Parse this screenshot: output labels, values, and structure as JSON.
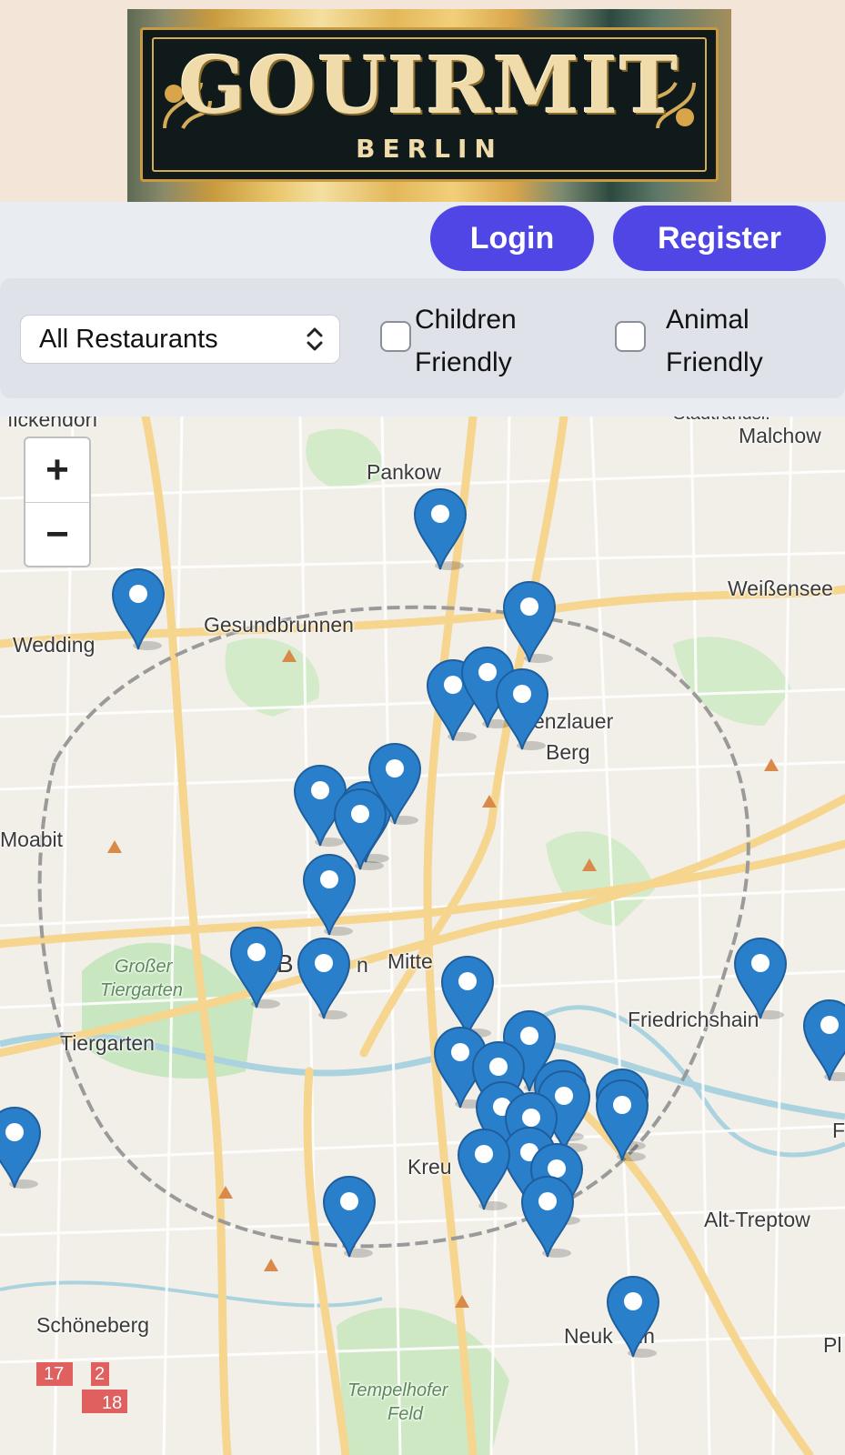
{
  "logo": {
    "title": "GOUIRMIT",
    "subtitle": "BERLIN"
  },
  "auth": {
    "login_label": "Login",
    "register_label": "Register"
  },
  "filters": {
    "restaurant_select": {
      "value": "All Restaurants"
    },
    "children_friendly": {
      "label": "Children Friendly",
      "checked": false
    },
    "animal_friendly": {
      "label": "Animal Friendly",
      "checked": false
    }
  },
  "map": {
    "zoom_in": "+",
    "zoom_out": "−",
    "labels": {
      "reinickendorf": "ıickendorf",
      "stadtrand": "Stadtrandsi.",
      "malchow": "Malchow",
      "pankow": "Pankow",
      "weissensee": "Weißensee",
      "gesundbrunnen": "Gesundbrunnen",
      "wedding": "Wedding",
      "prenzlauer": "enzlauer",
      "berg": "Berg",
      "moabit": "Moabit",
      "grosser": "Großer",
      "tiergarten_park": "Tiergarten",
      "berlin_b": "B",
      "berlin_n": "n",
      "mitte": "Mitte",
      "tiergarten": "Tiergarten",
      "friedrichshain": "Friedrichshain",
      "f_edge": "F",
      "kreuzberg": "Kreu",
      "alt_treptow": "Alt-Treptow",
      "schoeneberg": "Schöneberg",
      "neukoelln_a": "Neuk",
      "neukoelln_b": "ln",
      "pl_edge": "Pl",
      "tempelhofer": "Tempelhofer",
      "feld": "Feld",
      "road_17": "17",
      "road_2": "2",
      "road_18": "18"
    }
  },
  "colors": {
    "primary": "#4f46e5",
    "marker": "#2a7fcb",
    "map_bg": "#f2efe9"
  }
}
